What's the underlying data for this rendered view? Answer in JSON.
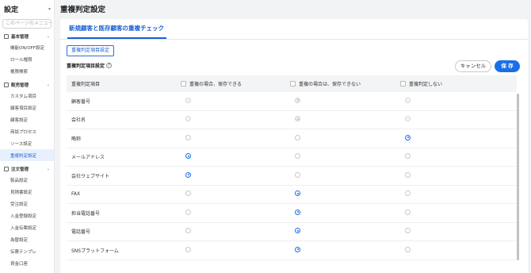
{
  "sidebar": {
    "title": "設定",
    "search_placeholder": "このページのメニュー",
    "groups": [
      {
        "label": "基本管理",
        "items": [
          "機能ON/OFF設定",
          "ロール権限",
          "権限検索"
        ]
      },
      {
        "label": "販売管理",
        "items": [
          "カスタム項目",
          "顧客項目設定",
          "顧客設定",
          "商談プロセス",
          "ソース設定",
          "重複判定設定"
        ]
      },
      {
        "label": "注文管理",
        "items": [
          "製品設定",
          "見積書設定",
          "受注設定",
          "入金登録設定",
          "入金伝票設定",
          "為替設定",
          "伝票テンプレ",
          "資金口座"
        ]
      }
    ],
    "active_item": "重複判定設定"
  },
  "page_title": "重複判定設定",
  "tab_label": "新規顧客と既存顧客の重複チェック",
  "sub_button_label": "重複判定項目設定",
  "section_label": "重複判定項目設定",
  "buttons": {
    "cancel": "キャンセル",
    "save": "保 存"
  },
  "table": {
    "headers": [
      "重複判定項目",
      "重複の場合、保存できる",
      "重複の場合は、保存できない",
      "重複判定しない"
    ],
    "rows": [
      {
        "label": "顧客番号",
        "states": [
          "disabled",
          "disabled-checked",
          "disabled"
        ]
      },
      {
        "label": "会社名",
        "states": [
          "disabled",
          "disabled-checked",
          "disabled"
        ]
      },
      {
        "label": "略称",
        "states": [
          "off",
          "off",
          "on"
        ]
      },
      {
        "label": "メールアドレス",
        "states": [
          "on",
          "off",
          "off"
        ]
      },
      {
        "label": "会社ウェブサイト",
        "states": [
          "on",
          "off",
          "off"
        ]
      },
      {
        "label": "FAX",
        "states": [
          "off",
          "on",
          "off"
        ]
      },
      {
        "label": "担当電話番号",
        "states": [
          "off",
          "on",
          "off"
        ]
      },
      {
        "label": "電話番号",
        "states": [
          "off",
          "on",
          "off"
        ]
      },
      {
        "label": "SNSプラットフォーム",
        "states": [
          "off",
          "on",
          "off"
        ]
      }
    ]
  }
}
